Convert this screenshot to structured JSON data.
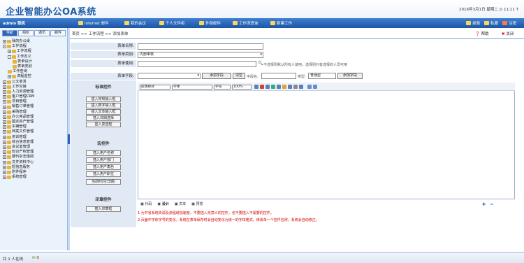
{
  "header": {
    "app_title": "企业智能办公OA系统",
    "date_text": "2016年3月1日 星期二 ◷ 11:11 T"
  },
  "topbar": {
    "user": "admin 联机",
    "items": [
      "Internet 邮件",
      "我的会议",
      "个人文件柜",
      "外部邮件",
      "工作流查询",
      "新建工作"
    ],
    "right_items": [
      "桌面",
      "私服",
      "注销"
    ]
  },
  "sidebar": {
    "tabs": [
      "导航",
      "组织",
      "通讯",
      "邮件"
    ],
    "tree": [
      {
        "label": "我的办公桌",
        "level": 0,
        "toggle": "+"
      },
      {
        "label": "工作流程",
        "level": 0,
        "toggle": "-"
      },
      {
        "label": "工作流程",
        "level": 1,
        "toggle": "+"
      },
      {
        "label": "工作定义",
        "level": 1,
        "toggle": "-"
      },
      {
        "label": "表单设计",
        "level": 2,
        "toggle": ""
      },
      {
        "label": "表单类别",
        "level": 2,
        "toggle": ""
      },
      {
        "label": "工作查询",
        "level": 1,
        "toggle": ""
      },
      {
        "label": "流程监控",
        "level": 1,
        "toggle": "+"
      },
      {
        "label": "公文收发",
        "level": 0,
        "toggle": "+"
      },
      {
        "label": "工作交接",
        "level": 0,
        "toggle": "+"
      },
      {
        "label": "人力资源管理",
        "level": 0,
        "toggle": "+"
      },
      {
        "label": "客户管理CRM",
        "level": 0,
        "toggle": "+"
      },
      {
        "label": "项目管理",
        "level": 0,
        "toggle": "+"
      },
      {
        "label": "销售订单管理",
        "level": 0,
        "toggle": "+"
      },
      {
        "label": "采购管理",
        "level": 0,
        "toggle": "+"
      },
      {
        "label": "办公用品管理",
        "level": 0,
        "toggle": "+"
      },
      {
        "label": "固定资产管理",
        "level": 0,
        "toggle": "+"
      },
      {
        "label": "车辆管理",
        "level": 0,
        "toggle": "+"
      },
      {
        "label": "档案文件管理",
        "level": 0,
        "toggle": "+"
      },
      {
        "label": "培训管理",
        "level": 0,
        "toggle": "+"
      },
      {
        "label": "综合信息管理",
        "level": 0,
        "toggle": "+"
      },
      {
        "label": "会议室管理",
        "level": 0,
        "toggle": "+"
      },
      {
        "label": "知识产权管理",
        "level": 0,
        "toggle": "+"
      },
      {
        "label": "期刊杂志借阅",
        "level": 0,
        "toggle": "+"
      },
      {
        "label": "文件资料中心",
        "level": 0,
        "toggle": "+"
      },
      {
        "label": "短信息服务",
        "level": 0,
        "toggle": "+"
      },
      {
        "label": "附件程序",
        "level": 0,
        "toggle": "+"
      },
      {
        "label": "系统管理",
        "level": 0,
        "toggle": "+"
      }
    ]
  },
  "breadcrumb": "首页 >> 工作流程 >> 添加表单",
  "actions": {
    "help": "帮助",
    "close": "关闭"
  },
  "form": {
    "name_label": "表单名称:",
    "category_label": "表单类别:",
    "category_value": "内部审核",
    "owner_label": "表单使用:",
    "owner_hint": "不选择则默认所有人使用，选择则只有选择的人员可用",
    "field_label": "表单字段:",
    "add_field_button": "添加字段",
    "clear_button": "清空",
    "field_name_label": "字段名:",
    "type_label": "类型:",
    "type_value": "普通型",
    "add_field_button2": "添加字段"
  },
  "left_panel": {
    "sections": [
      {
        "title": "标准控件",
        "buttons": [
          "插入常规输入框",
          "插入数字输入框",
          "插入文本输入框",
          "插入日期选择",
          "插入复选框"
        ]
      },
      {
        "title": "宏控件",
        "buttons": [
          "插入用户名称",
          "插入用户部门",
          "插入用户角色",
          "插入用户职位",
          "当前时间(日期)"
        ]
      },
      {
        "title": "印章控件",
        "buttons": [
          "插入印章框"
        ]
      }
    ]
  },
  "editor": {
    "font_style": "段落样式",
    "font_name": "字体",
    "font_size": "字号",
    "zoom": "100%",
    "tabs": [
      "代码",
      "设计",
      "文本",
      "预览"
    ]
  },
  "notes": [
    "1.为节省系统资源及流程增加速度，不要插入无意义的控件，也不要插入不需要的控件。",
    "2.页面中字体字号的变化，系统在表单保存时会自动变化为统一的字体格式。修改单一个控件名称，系统会自动修正。"
  ],
  "status": {
    "text": "共 1 人在线",
    "mail_count": "0"
  }
}
